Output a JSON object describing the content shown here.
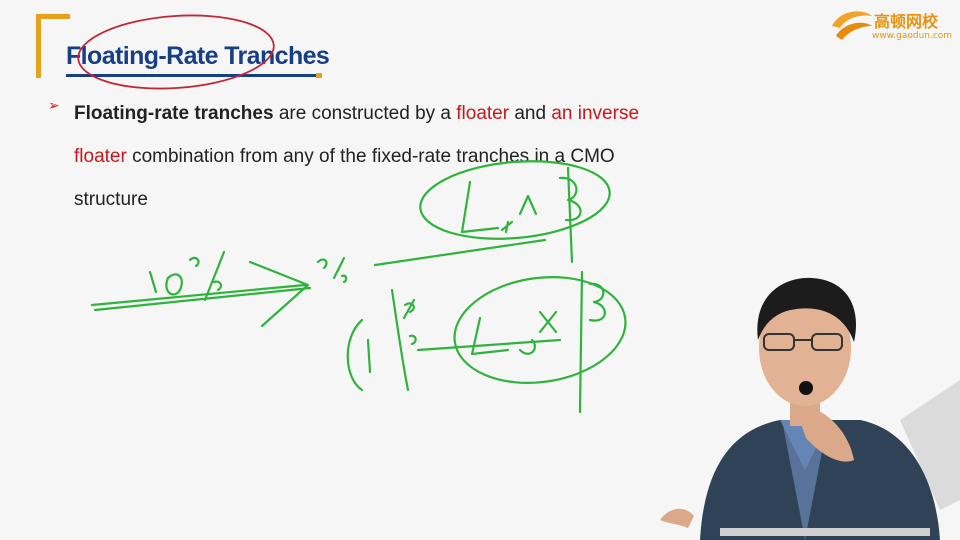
{
  "slide": {
    "title": "Floating-Rate Tranches",
    "bullet_glyph": "➢",
    "body": {
      "term": "Floating-rate tranches",
      "part1": " are constructed by a ",
      "floater": "floater",
      "and": " and ",
      "inverse_line1": "an inverse",
      "inverse_line2": "floater",
      "part2": " combination from any of the fixed-rate tranches in a CMO",
      "part3": "structure"
    }
  },
  "logo": {
    "brand": "高顿网校",
    "url": "www.gaodun.com",
    "icon": "gaodun-swirl-icon"
  },
  "colors": {
    "title": "#173f86",
    "accent_orange": "#e8a11a",
    "red_text": "#c8161d",
    "ink_green": "#2fb33c",
    "ink_red": "#c0283a",
    "background": "#f6f6f6"
  }
}
